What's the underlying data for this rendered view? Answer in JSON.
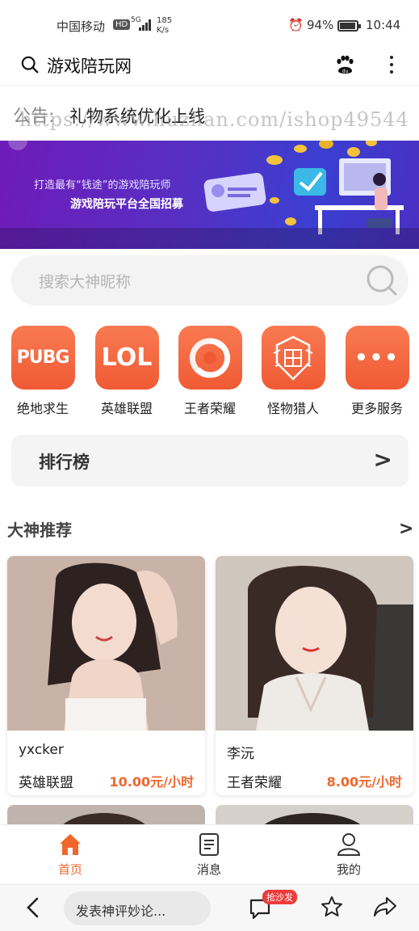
{
  "status_bar": {
    "carrier": "中国移动",
    "hd": "HD",
    "signal_label": "5G",
    "speed_value": "185",
    "speed_unit": "K/s",
    "battery": "94%",
    "battery_level": 0.94,
    "time": "10:44"
  },
  "header": {
    "title": "游戏陪玩网",
    "icons": [
      "search-icon",
      "baidu-paw-icon",
      "more-vertical-icon"
    ]
  },
  "notice": {
    "label": "公告:",
    "message": "礼物系统优化上线",
    "watermark": "https://www.huzhan.com/ishop49544"
  },
  "banner": {
    "line1": "打造最有“钱途”的游戏陪玩师",
    "line2": "游戏陪玩平台全国招募"
  },
  "search": {
    "placeholder": "搜索大神昵称"
  },
  "categories": [
    {
      "name": "绝地求生",
      "tile_text": "PUBG",
      "icon": "pubg-icon"
    },
    {
      "name": "英雄联盟",
      "tile_text": "LOL",
      "icon": "lol-icon"
    },
    {
      "name": "王者荣耀",
      "tile_text": "",
      "icon": "honor-of-kings-icon"
    },
    {
      "name": "怪物猎人",
      "tile_text": "",
      "icon": "monster-hunter-icon"
    },
    {
      "name": "更多服务",
      "tile_text": "•••",
      "icon": "more-services-icon"
    }
  ],
  "ranking": {
    "label": "排行榜",
    "arrow": ">"
  },
  "recommend": {
    "title": "大神推荐",
    "more": ">",
    "players": [
      {
        "name": "yxcker",
        "game": "英雄联盟",
        "price": "10.00元/小时"
      },
      {
        "name": "李沅",
        "game": "王者荣耀",
        "price": "8.00元/小时"
      }
    ]
  },
  "tabbar": {
    "items": [
      {
        "label": "首页",
        "icon": "home-icon",
        "active": true
      },
      {
        "label": "消息",
        "icon": "message-icon",
        "active": false
      },
      {
        "label": "我的",
        "icon": "profile-icon",
        "active": false
      }
    ]
  },
  "browser_bar": {
    "comment_placeholder": "发表神评妙论...",
    "badge": "抢沙发",
    "icons": [
      "back-icon",
      "comment-icon",
      "star-icon",
      "share-icon"
    ]
  },
  "colors": {
    "accent": "#f0672e",
    "tile": "#f26640",
    "banner": "#5630c4"
  }
}
